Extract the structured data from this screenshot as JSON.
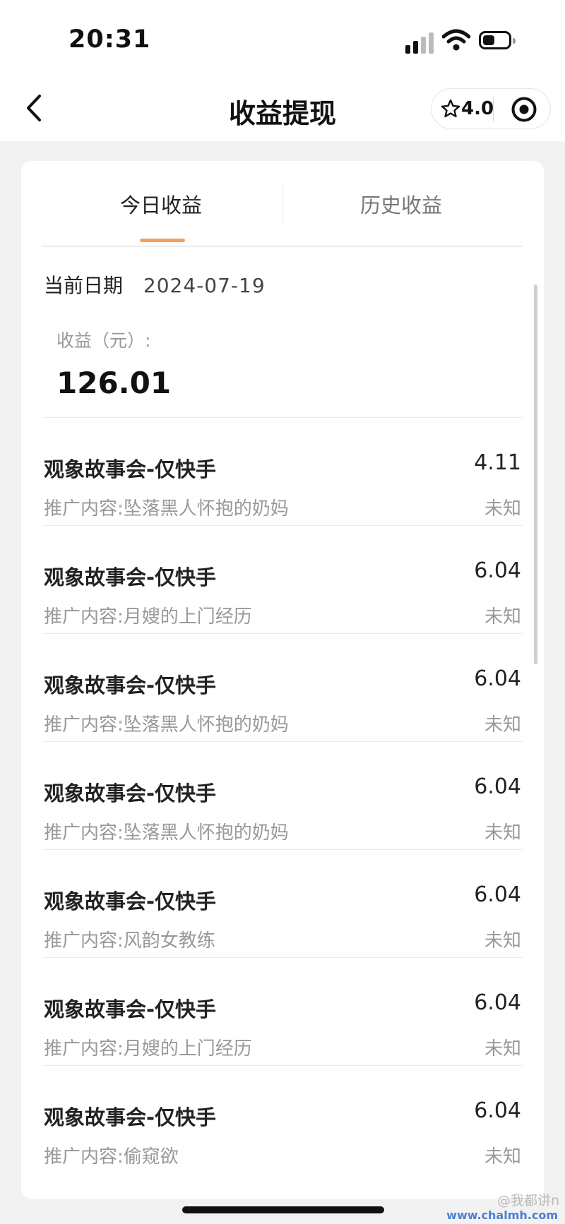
{
  "status_bar": {
    "time": "20:31"
  },
  "nav": {
    "title": "收益提现",
    "rating": "4.0"
  },
  "tabs": [
    {
      "label": "今日收益",
      "active": true
    },
    {
      "label": "历史收益",
      "active": false
    }
  ],
  "summary": {
    "date_label": "当前日期",
    "date_value": "2024-07-19",
    "earnings_label": "收益（元）:",
    "earnings_value": "126.01"
  },
  "items": [
    {
      "name": "观象故事会-仅快手",
      "amount": "4.11",
      "desc": "推广内容:坠落黑人怀抱的奶妈",
      "status": "未知"
    },
    {
      "name": "观象故事会-仅快手",
      "amount": "6.04",
      "desc": "推广内容:月嫂的上门经历",
      "status": "未知"
    },
    {
      "name": "观象故事会-仅快手",
      "amount": "6.04",
      "desc": "推广内容:坠落黑人怀抱的奶妈",
      "status": "未知"
    },
    {
      "name": "观象故事会-仅快手",
      "amount": "6.04",
      "desc": "推广内容:坠落黑人怀抱的奶妈",
      "status": "未知"
    },
    {
      "name": "观象故事会-仅快手",
      "amount": "6.04",
      "desc": "推广内容:风韵女教练",
      "status": "未知"
    },
    {
      "name": "观象故事会-仅快手",
      "amount": "6.04",
      "desc": "推广内容:月嫂的上门经历",
      "status": "未知"
    },
    {
      "name": "观象故事会-仅快手",
      "amount": "6.04",
      "desc": "推广内容:偷窥欲",
      "status": "未知"
    }
  ],
  "watermark": {
    "text": "@我都讲n",
    "url": "www.chalmh.com"
  },
  "colors": {
    "accent": "#f0a05a",
    "background": "#f2f2f2",
    "muted_text": "#999999"
  },
  "icons": [
    "back-chevron-icon",
    "star-icon",
    "target-icon",
    "signal-icon",
    "wifi-icon",
    "battery-icon"
  ]
}
